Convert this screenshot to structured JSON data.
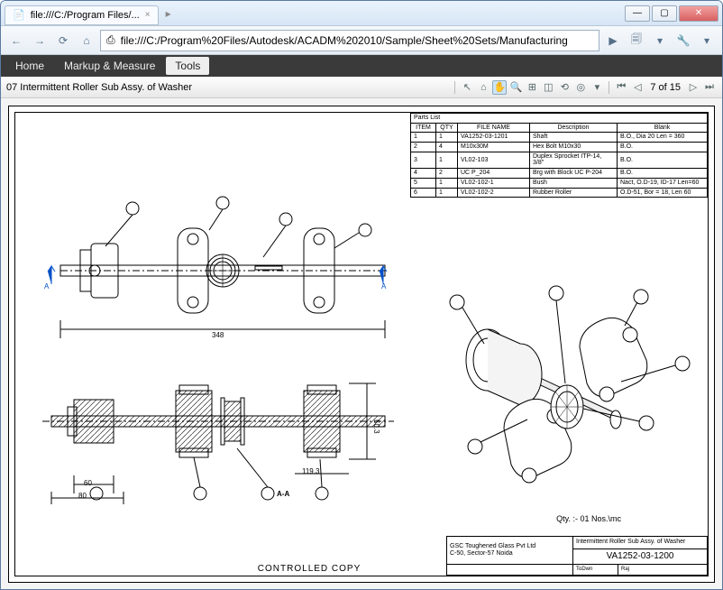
{
  "window": {
    "tab_title": "file:///C:/Program Files/...",
    "minimize": "—",
    "maximize": "▢",
    "close": "✕"
  },
  "nav": {
    "back": "←",
    "forward": "→",
    "reload": "⟳",
    "url_icon": "⎙",
    "url": "file:///C:/Program%20Files/Autodesk/ACADM%202010/Sample/Sheet%20Sets/Manufacturing",
    "play": "▶",
    "page": "🗐",
    "wrench": "🔧"
  },
  "menu": {
    "home": "Home",
    "markup": "Markup & Measure",
    "tools": "Tools"
  },
  "toolbar": {
    "doc_title": "07 Intermittent Roller Sub Assy. of Washer",
    "page_info": "7 of 15"
  },
  "parts_list": {
    "title": "Parts List",
    "headers": {
      "item": "ITEM",
      "qty": "QTY",
      "file": "FILE NAME",
      "desc": "Description",
      "blank": "Blank"
    },
    "rows": [
      {
        "item": "1",
        "qty": "1",
        "file": "VA1252-03-1201",
        "desc": "Shaft",
        "blank": "B.O., Dia 20 Len = 360"
      },
      {
        "item": "2",
        "qty": "4",
        "file": "M10x30M",
        "desc": "Hex Bolt M10x30",
        "blank": "B.O."
      },
      {
        "item": "3",
        "qty": "1",
        "file": "VL02-103",
        "desc": "Duplex Sprocket ITP-14, 3/8\"",
        "blank": "B.O."
      },
      {
        "item": "4",
        "qty": "2",
        "file": "UC P_204",
        "desc": "Brg with Block UC P-204",
        "blank": "B.O."
      },
      {
        "item": "5",
        "qty": "1",
        "file": "VL02-102-1",
        "desc": "Bush",
        "blank": "Nact, O.D-19, ID-17 Len=60"
      },
      {
        "item": "6",
        "qty": "1",
        "file": "VL02-102-2",
        "desc": "Rubber Roller",
        "blank": "O.D-51, Bor = 18, Len 60"
      }
    ]
  },
  "drawing": {
    "section_a": "A",
    "section_aa": "A-A",
    "qty_note": "Qty. :- 01 Nos.\\mc",
    "controlled": "CONTROLLED COPY",
    "dims": {
      "d1": "348",
      "d2": "60",
      "d3": "119.3",
      "d4": "50.3",
      "d5": "80"
    }
  },
  "titleblock": {
    "company": "GSC Toughened Glass Pvt Ltd",
    "address": "C-50, Sector-57 Noida",
    "title": "Intermittent Roller Sub Assy. of Washer",
    "dwgno": "VA1252-03-1200",
    "lbl1": "ToDwn",
    "lbl2": "Raj"
  }
}
